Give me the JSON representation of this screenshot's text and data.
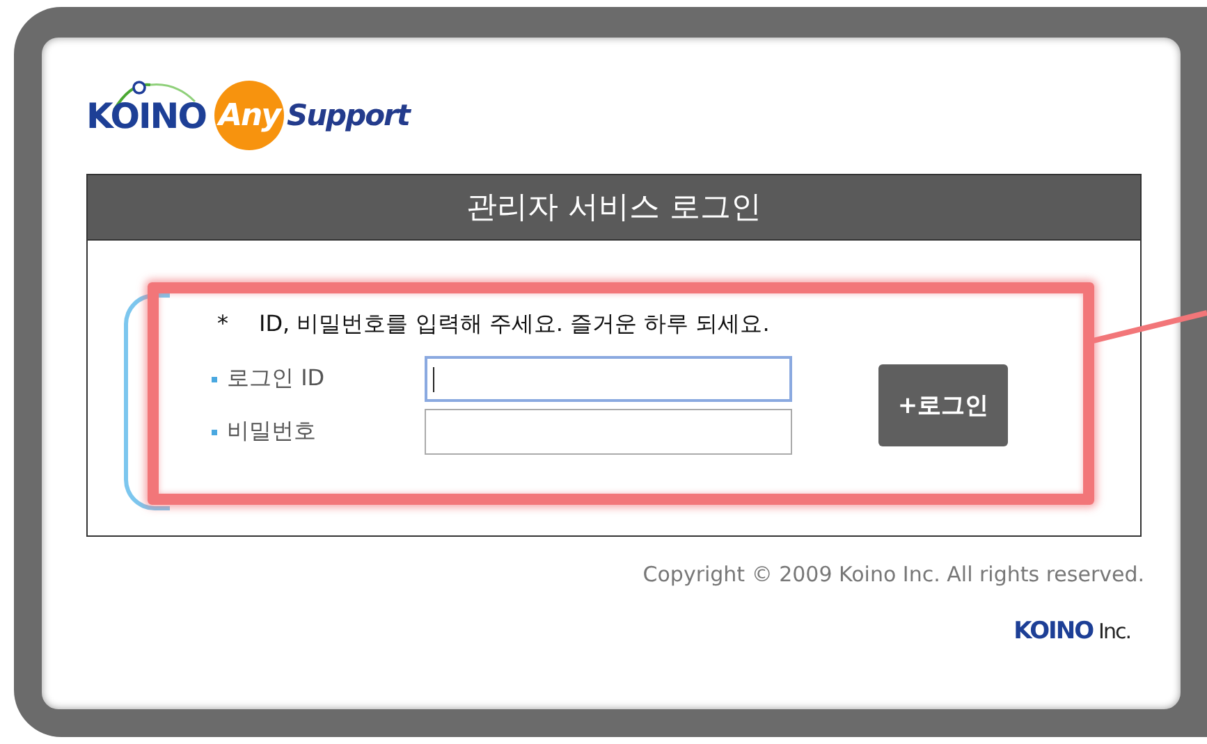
{
  "logo": {
    "brand": "KOINO",
    "badge": "Any",
    "product": "Support"
  },
  "login_panel": {
    "title": "관리자 서비스 로그인",
    "notice_mark": "*",
    "notice": "ID, 비밀번호를 입력해 주세요. 즐거운 하루 되세요.",
    "fields": [
      {
        "label": "로그인 ID",
        "focused": true
      },
      {
        "label": "비밀번호",
        "focused": false
      }
    ],
    "login_button": "+로그인"
  },
  "footer": {
    "copyright": "Copyright © 2009 Koino Inc. All rights reserved.",
    "brand": "KOINO",
    "suffix": "Inc."
  }
}
